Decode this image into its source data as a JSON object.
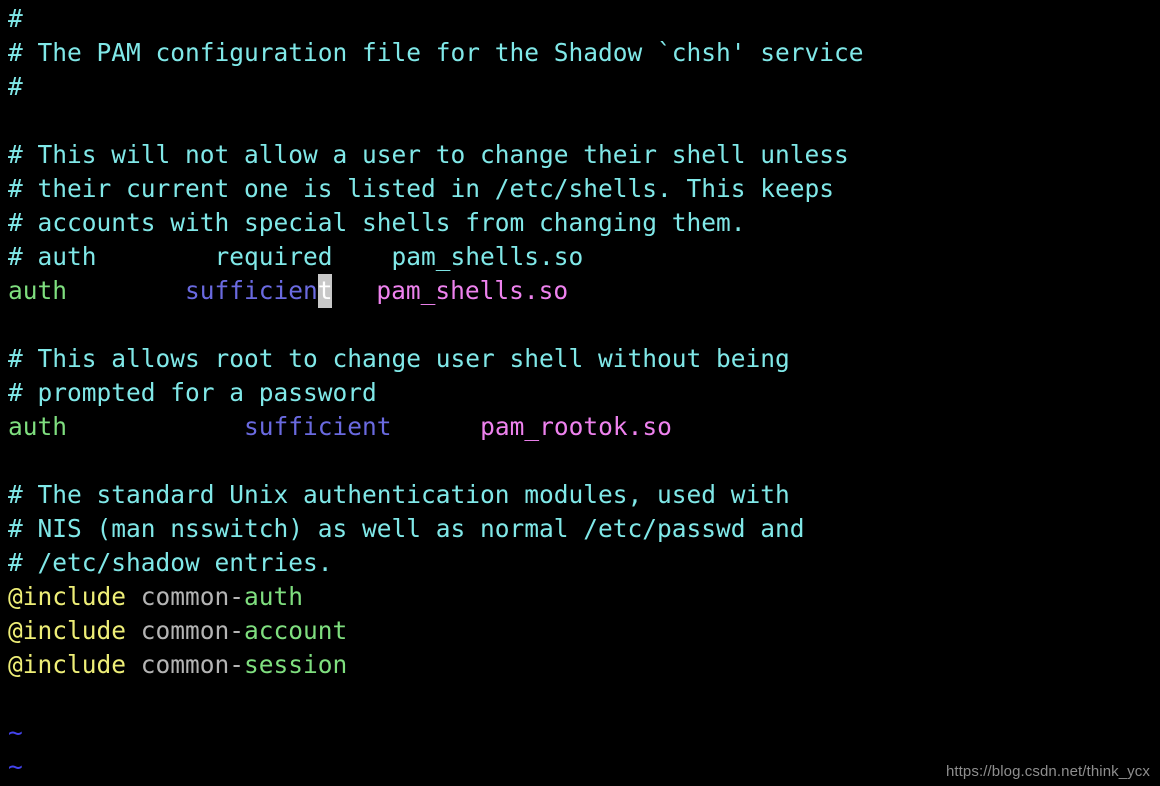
{
  "editor": {
    "name": "vim",
    "background": "#000000",
    "cursor": {
      "char": "t",
      "line_index": 8,
      "column": 20,
      "block_color": "#c8c8c8",
      "text_color": "#ffffff"
    },
    "empty_line_marker": "~",
    "empty_line_marker_color": "#4444ee"
  },
  "colors": {
    "comment": "#80e8e8",
    "keyword": "#7fdf7f",
    "control": "#6a6ae0",
    "module": "#ee82ee",
    "include": "#eeee77",
    "plain": "#b4b4b4",
    "tilde": "#4444ee",
    "watermark": "#8e8e8e"
  },
  "lines": [
    {
      "n": 1,
      "segments": [
        {
          "text": "#",
          "cls": "c-comment"
        }
      ]
    },
    {
      "n": 2,
      "segments": [
        {
          "text": "# The PAM configuration file for the Shadow `chsh' service",
          "cls": "c-comment"
        }
      ]
    },
    {
      "n": 3,
      "segments": [
        {
          "text": "#",
          "cls": "c-comment"
        }
      ]
    },
    {
      "n": 4,
      "segments": [
        {
          "text": "",
          "cls": "c-comment"
        }
      ]
    },
    {
      "n": 5,
      "segments": [
        {
          "text": "# This will not allow a user to change their shell unless",
          "cls": "c-comment"
        }
      ]
    },
    {
      "n": 6,
      "segments": [
        {
          "text": "# their current one is listed in /etc/shells. This keeps",
          "cls": "c-comment"
        }
      ]
    },
    {
      "n": 7,
      "segments": [
        {
          "text": "# accounts with special shells from changing them.",
          "cls": "c-comment"
        }
      ]
    },
    {
      "n": 8,
      "segments": [
        {
          "text": "# auth        required    pam_shells.so",
          "cls": "c-comment"
        }
      ]
    },
    {
      "n": 9,
      "segments": [
        {
          "text": "auth",
          "cls": "c-keyword"
        },
        {
          "text": "        ",
          "cls": "c-plain"
        },
        {
          "text": "sufficien",
          "cls": "c-control"
        },
        {
          "text": "t",
          "cls": "c-control",
          "cursor": true
        },
        {
          "text": "   ",
          "cls": "c-plain"
        },
        {
          "text": "pam_shells.so",
          "cls": "c-module"
        }
      ]
    },
    {
      "n": 10,
      "segments": [
        {
          "text": "",
          "cls": "c-comment"
        }
      ]
    },
    {
      "n": 11,
      "segments": [
        {
          "text": "# This allows root to change user shell without being",
          "cls": "c-comment"
        }
      ]
    },
    {
      "n": 12,
      "segments": [
        {
          "text": "# prompted for a password",
          "cls": "c-comment"
        }
      ]
    },
    {
      "n": 13,
      "segments": [
        {
          "text": "auth",
          "cls": "c-keyword"
        },
        {
          "text": "            ",
          "cls": "c-plain"
        },
        {
          "text": "sufficient",
          "cls": "c-control"
        },
        {
          "text": "      ",
          "cls": "c-plain"
        },
        {
          "text": "pam_rootok.so",
          "cls": "c-module"
        }
      ]
    },
    {
      "n": 14,
      "segments": [
        {
          "text": "",
          "cls": "c-comment"
        }
      ]
    },
    {
      "n": 15,
      "segments": [
        {
          "text": "# The standard Unix authentication modules, used with",
          "cls": "c-comment"
        }
      ]
    },
    {
      "n": 16,
      "segments": [
        {
          "text": "# NIS (man nsswitch) as well as normal /etc/passwd and",
          "cls": "c-comment"
        }
      ]
    },
    {
      "n": 17,
      "segments": [
        {
          "text": "# /etc/shadow entries.",
          "cls": "c-comment"
        }
      ]
    },
    {
      "n": 18,
      "segments": [
        {
          "text": "@include",
          "cls": "c-include"
        },
        {
          "text": " common-",
          "cls": "c-plain"
        },
        {
          "text": "auth",
          "cls": "c-keyword"
        }
      ]
    },
    {
      "n": 19,
      "segments": [
        {
          "text": "@include",
          "cls": "c-include"
        },
        {
          "text": " common-",
          "cls": "c-plain"
        },
        {
          "text": "account",
          "cls": "c-keyword"
        }
      ]
    },
    {
      "n": 20,
      "segments": [
        {
          "text": "@include",
          "cls": "c-include"
        },
        {
          "text": " common-",
          "cls": "c-plain"
        },
        {
          "text": "session",
          "cls": "c-keyword"
        }
      ]
    },
    {
      "n": 21,
      "segments": [
        {
          "text": "",
          "cls": "c-comment"
        }
      ]
    },
    {
      "n": 22,
      "segments": [
        {
          "text": "~",
          "cls": "c-tilde"
        }
      ]
    },
    {
      "n": 23,
      "segments": [
        {
          "text": "~",
          "cls": "c-tilde"
        }
      ]
    }
  ],
  "watermark": {
    "text": "https://blog.csdn.net/think_ycx"
  }
}
